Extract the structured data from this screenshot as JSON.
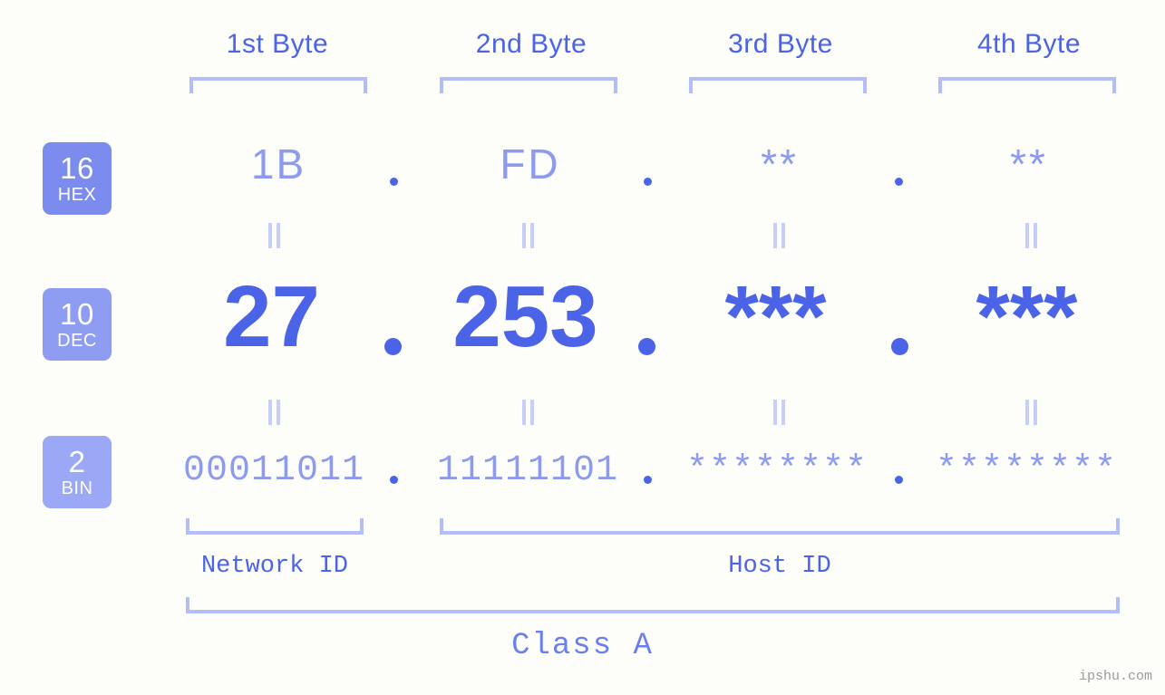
{
  "background": "#fdfdfa",
  "colors": {
    "accent_strong": "#4a63e7",
    "accent_mid": "#8c9af0",
    "accent_light": "#b3bdf7",
    "bracket": "#b3bdf7",
    "connector": "#c6cef9",
    "badge_hex": "#7b8cee",
    "badge_dec": "#8e9cf2",
    "badge_bin": "#9aa8f5",
    "watermark": "#9a9a9a"
  },
  "byte_headers": [
    {
      "label": "1st Byte"
    },
    {
      "label": "2nd Byte"
    },
    {
      "label": "3rd Byte"
    },
    {
      "label": "4th Byte"
    }
  ],
  "rows": [
    {
      "key": "hex",
      "badge": {
        "number": "16",
        "unit": "HEX"
      },
      "values": [
        "1B",
        "FD",
        "**",
        "**"
      ]
    },
    {
      "key": "dec",
      "badge": {
        "number": "10",
        "unit": "DEC"
      },
      "values": [
        "27",
        "253",
        "***",
        "***"
      ]
    },
    {
      "key": "bin",
      "badge": {
        "number": "2",
        "unit": "BIN"
      },
      "values": [
        "00011011",
        "11111101",
        "********",
        "********"
      ]
    }
  ],
  "separator": ".",
  "id_sections": [
    {
      "label": "Network ID"
    },
    {
      "label": "Host ID"
    }
  ],
  "class": {
    "label": "Class A"
  },
  "watermark": {
    "text": "ipshu.com"
  }
}
